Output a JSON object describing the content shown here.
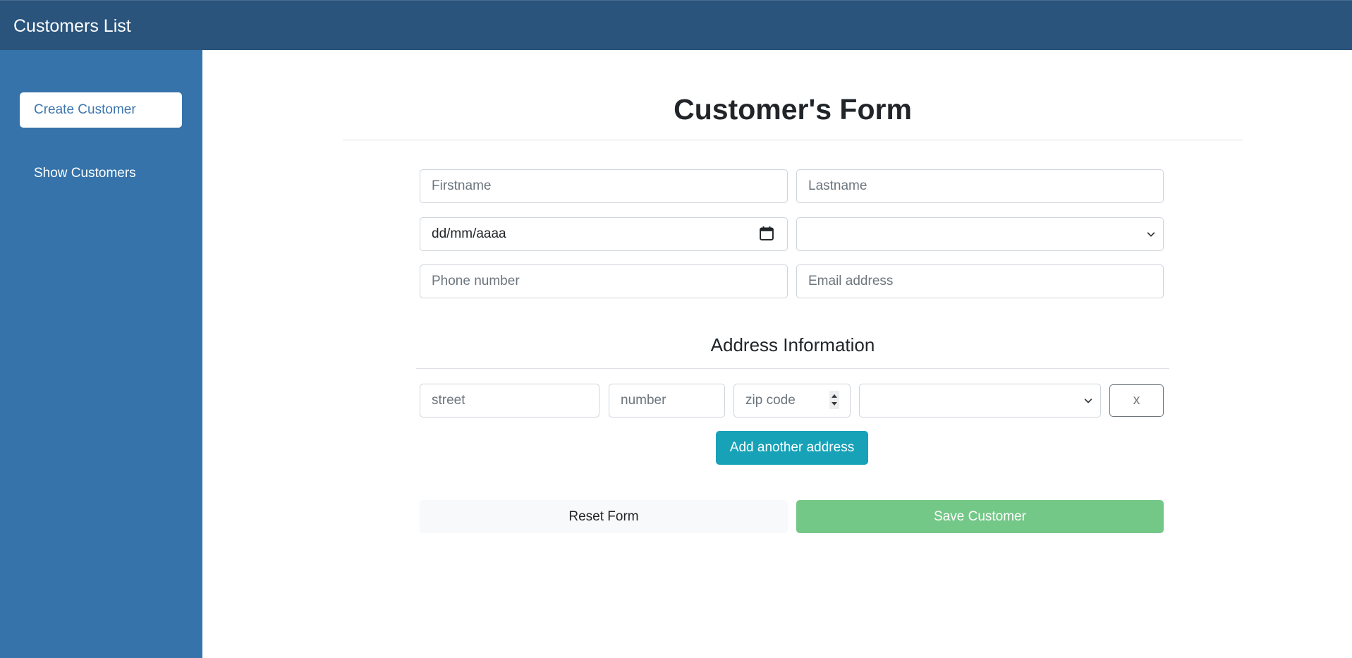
{
  "app": {
    "title": "Customers List"
  },
  "sidebar": {
    "items": [
      {
        "label": "Create Customer",
        "active": true
      },
      {
        "label": "Show Customers",
        "active": false
      }
    ]
  },
  "form": {
    "title": "Customer's Form",
    "firstname": {
      "placeholder": "Firstname",
      "value": ""
    },
    "lastname": {
      "placeholder": "Lastname",
      "value": ""
    },
    "birthdate": {
      "display": "dd/mm/aaaa"
    },
    "gender_select": {
      "selected": ""
    },
    "phone": {
      "placeholder": "Phone number",
      "value": ""
    },
    "email": {
      "placeholder": "Email address",
      "value": ""
    }
  },
  "address": {
    "title": "Address Information",
    "street": {
      "placeholder": "street",
      "value": ""
    },
    "number": {
      "placeholder": "number",
      "value": ""
    },
    "zip": {
      "placeholder": "zip code",
      "value": ""
    },
    "city_select": {
      "selected": ""
    },
    "remove_label": "x",
    "add_label": "Add another address"
  },
  "actions": {
    "reset_label": "Reset Form",
    "save_label": "Save Customer"
  },
  "icons": {
    "calendar": "calendar-icon",
    "chevron": "chevron-down-icon",
    "spinner": "spinner-icon"
  },
  "colors": {
    "topbar": "#2a547c",
    "sidebar": "#3573aa",
    "info_button": "#17a2b8",
    "success_button": "#74c887",
    "light_button": "#f8f9fa"
  }
}
